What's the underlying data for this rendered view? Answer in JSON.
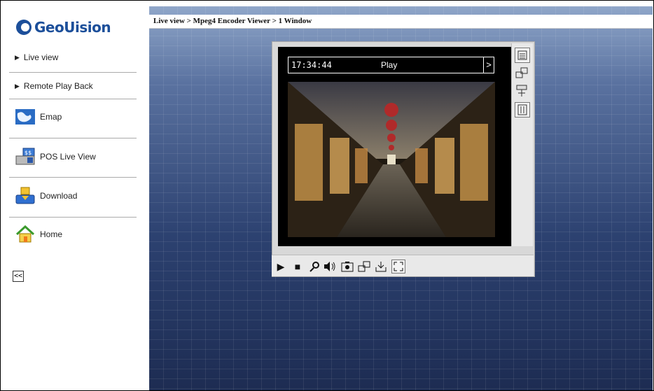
{
  "brand": {
    "logo_text": "GeoUision"
  },
  "sidebar": {
    "items": [
      {
        "label": "Live view",
        "icon": "arrow-right-icon"
      },
      {
        "label": "Remote Play Back",
        "icon": "arrow-right-icon"
      },
      {
        "label": "Emap",
        "icon": "map-icon"
      },
      {
        "label": "POS Live View",
        "icon": "pos-terminal-icon"
      },
      {
        "label": "Download",
        "icon": "download-icon"
      },
      {
        "label": "Home",
        "icon": "home-icon"
      }
    ],
    "collapse_label": "<<"
  },
  "breadcrumb": "Live view > Mpeg4 Encoder Viewer > 1 Window",
  "viewer": {
    "time": "17:34:44",
    "status": "Play",
    "next_label": ">"
  },
  "toolbar": {
    "icons": [
      "play-icon",
      "stop-icon",
      "microphone-icon",
      "speaker-icon",
      "snapshot-icon",
      "window-switch-icon",
      "save-icon",
      "fullscreen-icon"
    ]
  },
  "right_tools": {
    "icons": [
      "list-icon",
      "window-switch-icon",
      "ptz-camera-icon",
      "settings-panel-icon"
    ]
  },
  "colors": {
    "brand": "#1c4f9a",
    "bg_top": "#8fa6c9",
    "bg_bottom": "#1d2c52"
  }
}
